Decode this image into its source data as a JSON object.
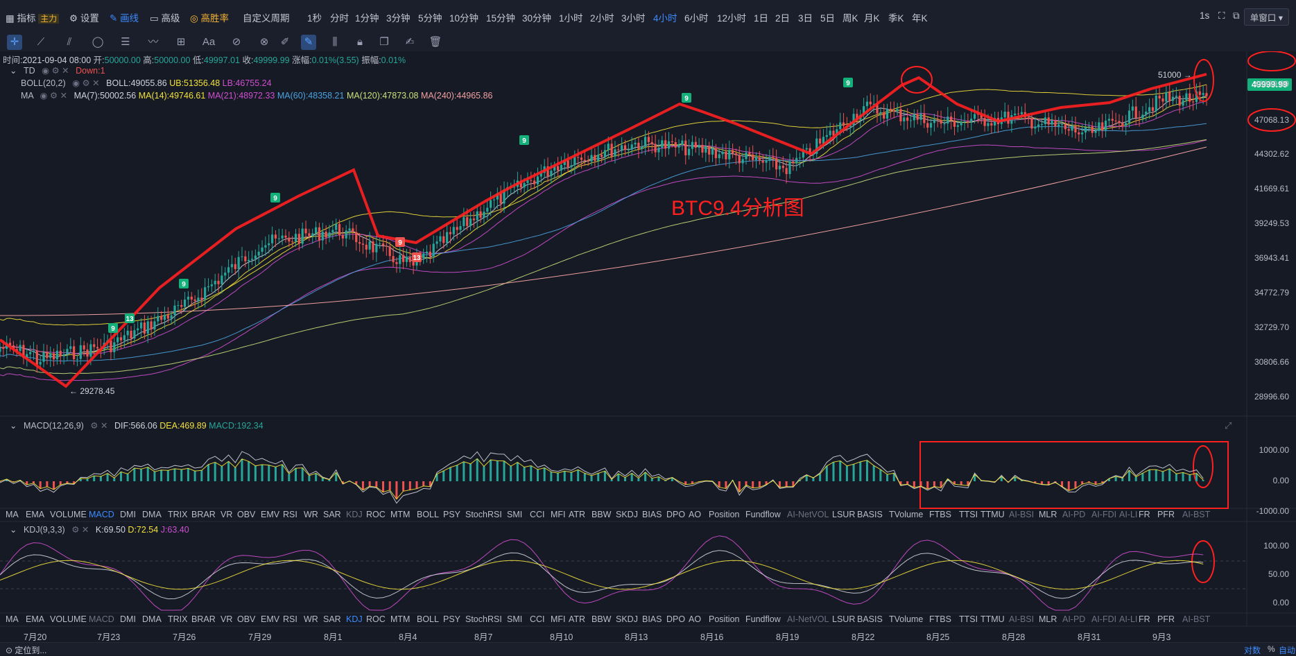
{
  "toolbar": {
    "items": [
      {
        "label": "指标",
        "tag": "主力"
      },
      {
        "label": "设置"
      },
      {
        "label": "画线"
      },
      {
        "label": "高级"
      },
      {
        "label": "高胜率"
      }
    ],
    "custom_period": "自定义周期",
    "periods": [
      "1秒",
      "分时",
      "1分钟",
      "3分钟",
      "5分钟",
      "10分钟",
      "15分钟",
      "30分钟",
      "1小时",
      "2小时",
      "3小时",
      "4小时",
      "6小时",
      "12小时",
      "1日",
      "2日",
      "3日",
      "5日",
      "周K",
      "月K",
      "季K",
      "年K"
    ],
    "active_period": "4小时",
    "right_interval": "1s",
    "window_mode": "单窗口"
  },
  "ohlc": {
    "time_label": "时间:",
    "time": "2021-09-04 08:00",
    "open_label": "开:",
    "open": "50000.00",
    "high_label": "高:",
    "high": "50000.00",
    "low_label": "低:",
    "low": "49997.01",
    "close_label": "收:",
    "close": "49999.99",
    "change_label": "涨幅:",
    "change": "0.01%(3.55)",
    "amp_label": "振幅:",
    "amp": "0.01%"
  },
  "indicators": {
    "td": {
      "name": "TD",
      "value": "Down:1"
    },
    "boll": {
      "name": "BOLL(20,2)",
      "boll": "BOLL:49055.86",
      "ub": "UB:51356.48",
      "lb": "LB:46755.24"
    },
    "ma": {
      "name": "MA",
      "ma7": "MA(7):50002.56",
      "ma14": "MA(14):49746.61",
      "ma21": "MA(21):48972.33",
      "ma60": "MA(60):48358.21",
      "ma120": "MA(120):47873.08",
      "ma240": "MA(240):44965.86"
    },
    "macd": {
      "name": "MACD(12,26,9)",
      "dif": "DIF:566.06",
      "dea": "DEA:469.89",
      "macd": "MACD:192.34"
    },
    "kdj": {
      "name": "KDJ(9,3,3)",
      "k": "K:69.50",
      "d": "D:72.54",
      "j": "J:63.40"
    }
  },
  "indicator_tabs": [
    "MA",
    "EMA",
    "VOLUME",
    "MACD",
    "DMI",
    "DMA",
    "TRIX",
    "BRAR",
    "VR",
    "OBV",
    "EMV",
    "RSI",
    "WR",
    "SAR",
    "KDJ",
    "ROC",
    "MTM",
    "BOLL",
    "PSY",
    "StochRSI",
    "SMI",
    "CCI",
    "MFI",
    "ATR",
    "BBW",
    "SKDJ",
    "BIAS",
    "DPO",
    "AO",
    "Position",
    "Fundflow",
    "AI-NetVOL",
    "LSUR",
    "BASIS",
    "TVolume",
    "FTBS",
    "TTSI",
    "TTMU",
    "AI-BSI",
    "MLR",
    "AI-PD",
    "AI-FDI",
    "AI-LI",
    "FR",
    "PFR",
    "AI-BST"
  ],
  "dim_tabs": [
    "AI-NetVOL",
    "AI-BSI",
    "AI-PD",
    "AI-FDI",
    "AI-LI",
    "AI-BST"
  ],
  "annotation": "BTC9.4分析图",
  "price_labels": {
    "high_mark": "51000",
    "low_mark": "29278.45",
    "current": "49999.99",
    "mark2": "47068.13"
  },
  "td_counts": [
    "9",
    "13",
    "9",
    "9",
    "9",
    "13",
    "9",
    "9",
    "9"
  ],
  "bottom": {
    "locate": "定位到...",
    "log": "对数",
    "pct": "%",
    "auto": "自动"
  },
  "colors": {
    "up": "#26a69a",
    "down": "#ef5350",
    "annot": "#ff2020",
    "active": "#3d8bfd",
    "bg": "#161a25"
  },
  "chart_data": [
    {
      "type": "candlestick",
      "title": "BTC9.4分析图",
      "x_dates": [
        "7月20",
        "7月23",
        "7月26",
        "7月29",
        "8月1",
        "8月4",
        "8月7",
        "8月10",
        "8月13",
        "8月16",
        "8月19",
        "8月22",
        "8月25",
        "8月28",
        "8月31",
        "9月3"
      ],
      "yticks": [
        51000,
        49999.99,
        47068.13,
        44302.62,
        41669.61,
        39249.53,
        36943.41,
        34772.79,
        32729.7,
        30806.66,
        28996.6
      ],
      "ytick_labels": [
        "",
        "49999.99",
        "47068.13",
        "44302.62",
        "41669.61",
        "39249.53",
        "36943.41",
        "34772.79",
        "32729.70",
        "30806.66",
        "28996.60"
      ],
      "approx_close_path": [
        {
          "x": "7月20",
          "y": 31600
        },
        {
          "x": "7月23",
          "y": 32700
        },
        {
          "x": "7月26",
          "y": 35500
        },
        {
          "x": "7月29",
          "y": 39800
        },
        {
          "x": "8月1",
          "y": 40800
        },
        {
          "x": "8月4",
          "y": 38200
        },
        {
          "x": "8月7",
          "y": 42500
        },
        {
          "x": "8月10",
          "y": 45600
        },
        {
          "x": "8月13",
          "y": 46900
        },
        {
          "x": "8月16",
          "y": 46300
        },
        {
          "x": "8月19",
          "y": 45100
        },
        {
          "x": "8月22",
          "y": 49400
        },
        {
          "x": "8月25",
          "y": 48300
        },
        {
          "x": "8月28",
          "y": 48700
        },
        {
          "x": "8月31",
          "y": 47500
        },
        {
          "x": "9月3",
          "y": 50000
        }
      ],
      "low_mark": 29278.45,
      "high_mark": 51000
    },
    {
      "type": "bar",
      "title": "MACD(12,26,9)",
      "ylim": [
        -1000,
        1000
      ],
      "yticks": [
        1000,
        0,
        -1000
      ],
      "ytick_labels": [
        "1000.00",
        "0.00",
        "-1000.00"
      ]
    },
    {
      "type": "line",
      "title": "KDJ(9,3,3)",
      "ylim": [
        0,
        110
      ],
      "yticks": [
        100,
        50,
        0
      ],
      "ytick_labels": [
        "100.00",
        "50.00",
        "0.00"
      ]
    }
  ]
}
